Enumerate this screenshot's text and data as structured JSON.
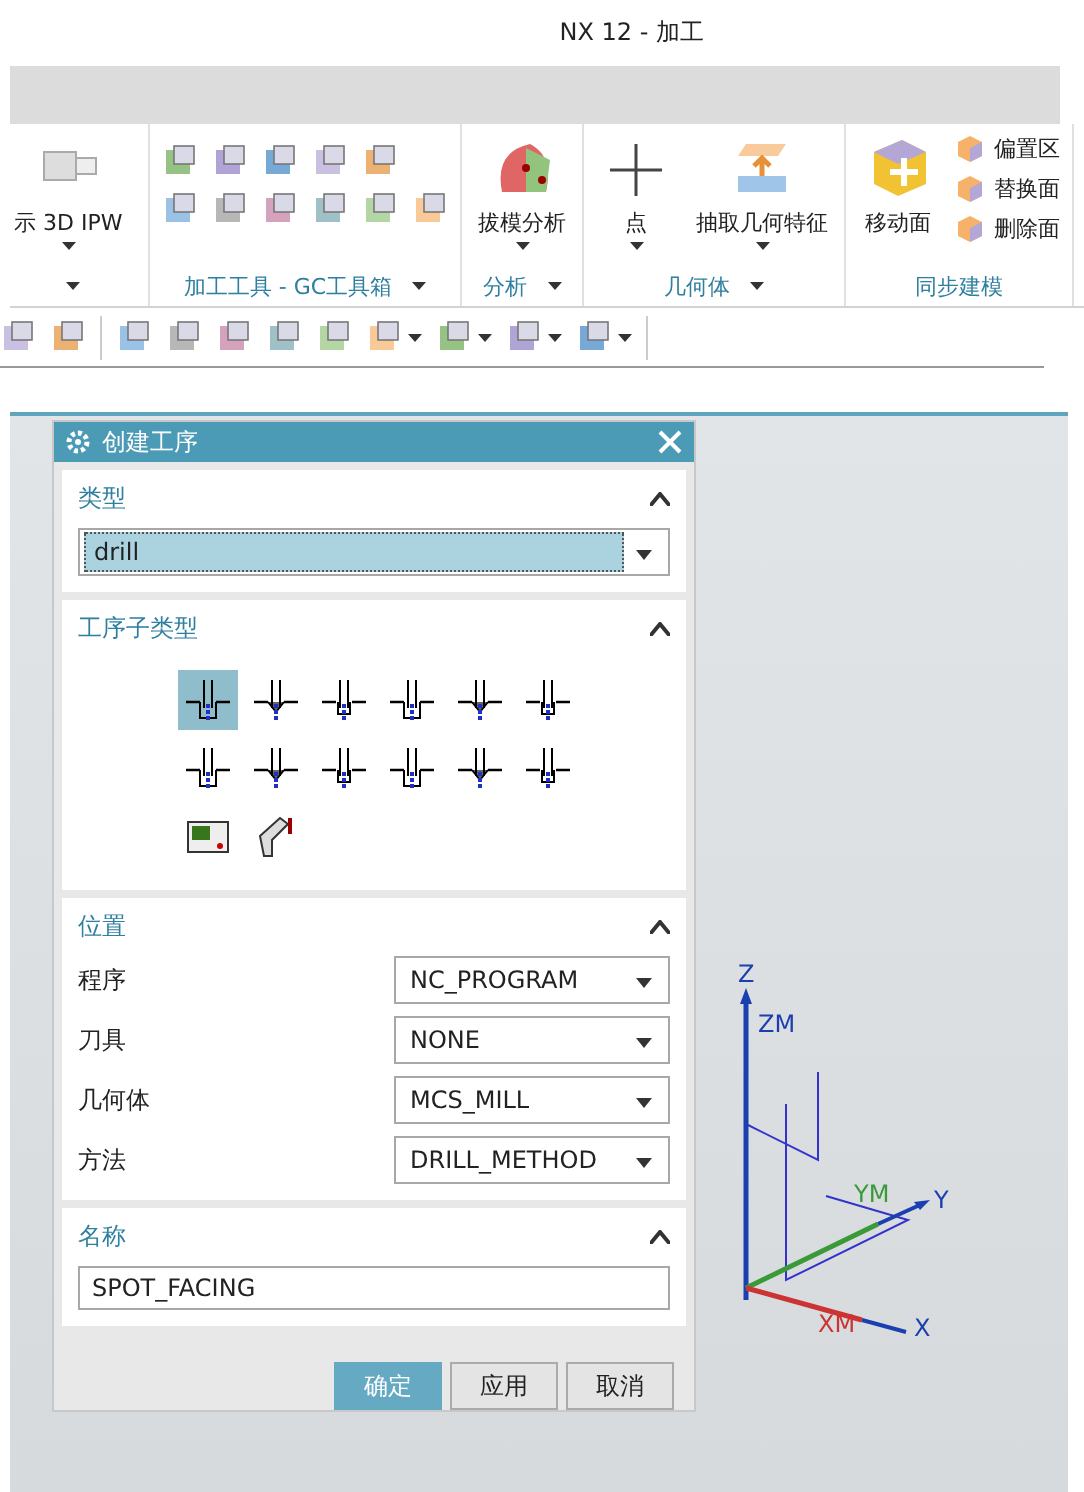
{
  "window": {
    "title": "NX 12 - 加工"
  },
  "ribbon": {
    "groups": [
      {
        "items": [
          {
            "kind": "large",
            "label": "示 3D IPW",
            "has_menu": true
          }
        ],
        "has_menu": true
      },
      {
        "caption": "加工工具 - GC工具箱",
        "items": [
          {
            "kind": "smallgrid"
          }
        ],
        "has_menu": true
      },
      {
        "caption": "分析",
        "items": [
          {
            "kind": "large",
            "label": "拔模分析",
            "has_menu": true
          }
        ],
        "has_menu": true
      },
      {
        "caption": "几何体",
        "items": [
          {
            "kind": "large",
            "label": "点",
            "has_menu": true
          },
          {
            "kind": "large",
            "label": "抽取几何特征",
            "has_menu": true
          }
        ],
        "has_menu": true
      },
      {
        "caption": "同步建模",
        "items": [
          {
            "kind": "large",
            "label": "移动面",
            "has_menu": false
          },
          {
            "kind": "list",
            "labels": [
              "偏置区",
              "替换面",
              "删除面"
            ]
          }
        ],
        "has_menu": false
      }
    ]
  },
  "toolbar": {
    "buttons": [
      {
        "has_menu": false
      },
      {
        "has_menu": false
      },
      {
        "has_menu": false
      },
      {
        "has_menu": false
      },
      {
        "has_menu": false
      },
      {
        "has_menu": false
      },
      {
        "has_menu": false
      },
      {
        "has_menu": true
      },
      {
        "has_menu": true
      },
      {
        "has_menu": true
      },
      {
        "has_menu": true
      }
    ]
  },
  "dialog": {
    "title": "创建工序",
    "type_section": {
      "title": "类型",
      "expanded": true,
      "value": "drill"
    },
    "subtype_section": {
      "title": "工序子类型",
      "expanded": true,
      "subtypes": [
        {
          "selected": true
        },
        {
          "selected": false
        },
        {
          "selected": false
        },
        {
          "selected": false
        },
        {
          "selected": false
        },
        {
          "selected": false
        },
        {
          "selected": false
        },
        {
          "selected": false
        },
        {
          "selected": false
        },
        {
          "selected": false
        },
        {
          "selected": false
        },
        {
          "selected": false
        },
        {
          "selected": false
        },
        {
          "selected": false
        }
      ]
    },
    "location_section": {
      "title": "位置",
      "expanded": true,
      "rows": [
        {
          "label": "程序",
          "value": "NC_PROGRAM"
        },
        {
          "label": "刀具",
          "value": "NONE"
        },
        {
          "label": "几何体",
          "value": "MCS_MILL"
        },
        {
          "label": "方法",
          "value": "DRILL_METHOD"
        }
      ]
    },
    "name_section": {
      "title": "名称",
      "expanded": true,
      "value": "SPOT_FACING"
    },
    "buttons": [
      {
        "label": "确定",
        "primary": true
      },
      {
        "label": "应用",
        "primary": false
      },
      {
        "label": "取消",
        "primary": false
      }
    ]
  },
  "axes": {
    "labels": [
      "Z",
      "ZM",
      "YM",
      "Y",
      "XM",
      "X"
    ]
  }
}
